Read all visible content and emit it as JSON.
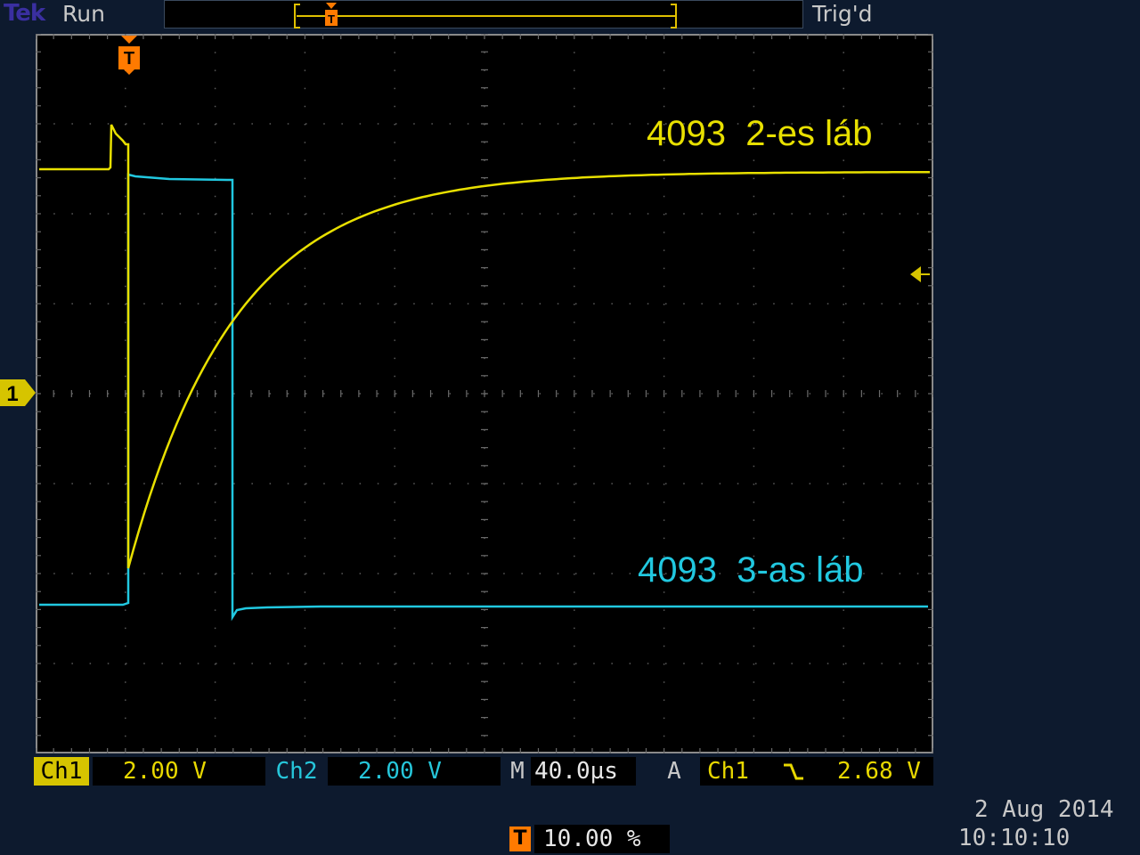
{
  "header": {
    "brand": "Tek",
    "acquisition_state": "Run",
    "trigger_state": "Trig'd"
  },
  "screen": {
    "ch1_label": "4093  2-es láb",
    "ch2_label": "4093  3-as láb",
    "ch1_marker": "1",
    "trigger_marker": "T"
  },
  "readouts": {
    "ch1_tag": "Ch1",
    "ch1_scale": "2.00 V",
    "ch2_tag": "Ch2",
    "ch2_scale": "2.00 V",
    "timebase_tag": "M",
    "timebase": "40.0µs",
    "trigger_tag": "A",
    "trigger_source": "Ch1",
    "trigger_level": "2.68 V",
    "trigger_slope_icon": "falling-edge-icon",
    "trigger_position_tag": "T",
    "trigger_position": "10.00 %"
  },
  "timestamp": {
    "date": "2 Aug 2014",
    "time": "10:10:10"
  },
  "colors": {
    "ch1": "#e8e000",
    "ch2": "#21c8e0",
    "trigger": "#ff7a00",
    "background": "#0d1a2e"
  }
}
